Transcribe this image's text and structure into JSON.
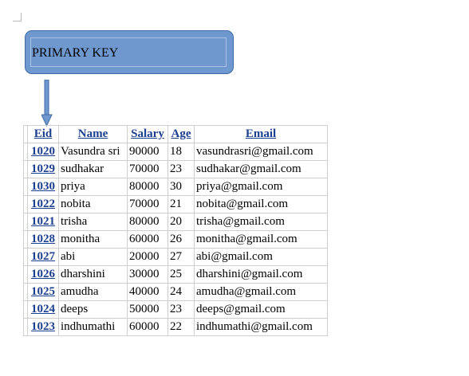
{
  "callout": {
    "label": "PRIMARY KEY"
  },
  "table": {
    "headers": {
      "eid": "Eid",
      "name": "Name",
      "salary": "Salary",
      "age": "Age",
      "email": "Email"
    },
    "rows": [
      {
        "eid": "1020",
        "name": "Vasundra sri",
        "salary": "90000",
        "age": "18",
        "email": "vasundrasri@gmail.com"
      },
      {
        "eid": "1029",
        "name": "sudhakar",
        "salary": "70000",
        "age": "23",
        "email": "sudhakar@gmail.com"
      },
      {
        "eid": "1030",
        "name": "priya",
        "salary": "80000",
        "age": "30",
        "email": "priya@gmail.com"
      },
      {
        "eid": "1022",
        "name": "nobita",
        "salary": "70000",
        "age": "21",
        "email": "nobita@gmail.com"
      },
      {
        "eid": "1021",
        "name": "trisha",
        "salary": "80000",
        "age": "20",
        "email": "trisha@gmail.com"
      },
      {
        "eid": "1028",
        "name": "monitha",
        "salary": "60000",
        "age": "26",
        "email": "monitha@gmail.com"
      },
      {
        "eid": "1027",
        "name": "abi",
        "salary": "20000",
        "age": "27",
        "email": "abi@gmail.com"
      },
      {
        "eid": "1026",
        "name": "dharshini",
        "salary": "30000",
        "age": "25",
        "email": "dharshini@gmail.com"
      },
      {
        "eid": "1025",
        "name": "amudha",
        "salary": "40000",
        "age": "24",
        "email": "amudha@gmail.com"
      },
      {
        "eid": "1024",
        "name": "deeps",
        "salary": "50000",
        "age": "23",
        "email": "deeps@gmail.com"
      },
      {
        "eid": "1023",
        "name": "indhumathi",
        "salary": "60000",
        "age": "22",
        "email": "indhumathi@gmail.com"
      }
    ]
  },
  "colors": {
    "callout_fill": "#6f98cf",
    "callout_border": "#3d6aa6",
    "key_text": "#1b3f8f",
    "grid": "#cfcfcf"
  }
}
